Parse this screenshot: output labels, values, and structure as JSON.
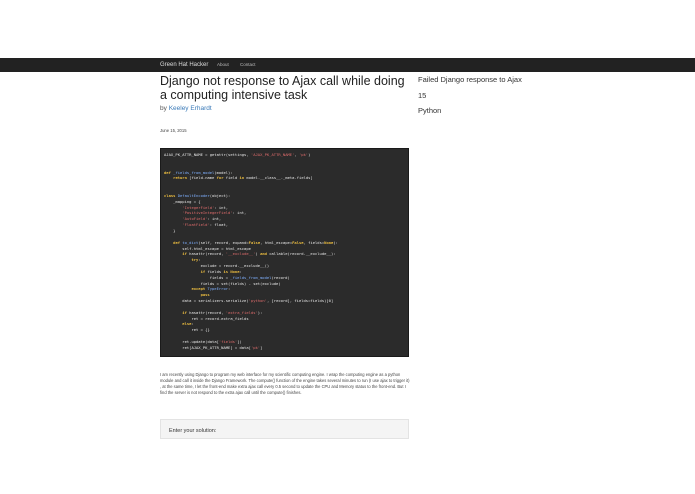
{
  "navbar": {
    "brand": "Green Hat Hacker",
    "links": [
      "About",
      "Contact"
    ]
  },
  "post": {
    "title": "Django not response to Ajax call while doing a computing intensive task",
    "by_label": "by",
    "author": "Keeley Erhardt",
    "date": "June 15, 2015",
    "code_lines": [
      "AJAX_PK_ATTR_NAME = getattr(settings, 'AJAX_PK_ATTR_NAME', 'pk')",
      "",
      "",
      "def _fields_from_model(model):",
      "    return [field.name for field in model.__class__._meta.fields]",
      "",
      "",
      "class DefaultEncoder(object):",
      "    _mapping = {",
      "        'IntegerField': int,",
      "        'PositiveIntegerField': int,",
      "        'AutoField': int,",
      "        'FloatField': float,",
      "    }",
      "",
      "    def to_dict(self, record, expand=False, html_escape=False, fields=None):",
      "        self.html_escape = html_escape",
      "        if hasattr(record, '__exclude__') and callable(record.__exclude__):",
      "            try:",
      "                exclude = record.__exclude__()",
      "                if fields is None:",
      "                    fields = _fields_from_model(record)",
      "                fields = set(fields) - set(exclude)",
      "            except TypeError:",
      "                pass",
      "        data = serializers.serialize('python', [record], fields=fields)[0]",
      "",
      "        if hasattr(record, 'extra_fields'):",
      "            ret = record.extra_fields",
      "        else:",
      "            ret = {}",
      "",
      "        ret.update(data['fields'])",
      "        ret[AJAX_PK_ATTR_NAME] = data['pk']"
    ],
    "description": "I am recently using Django to program my web interface for my scientific computing engine. I wrap the computing engine as a python module and call it inside the Django Framework. The compute() function of the engine takes several minutes to run (I use ajax to trigger it) , at the same time, I let the front-end make extra ajax call every 0.5 second to update the CPU and Memory status to the front-end. But I find the server is not respond to the extra ajax call until the compute() finishes.",
    "solution_label": "Enter your solution:"
  },
  "sidebar": {
    "title": "Failed Django response to Ajax",
    "count": "15",
    "tag": "Python"
  }
}
